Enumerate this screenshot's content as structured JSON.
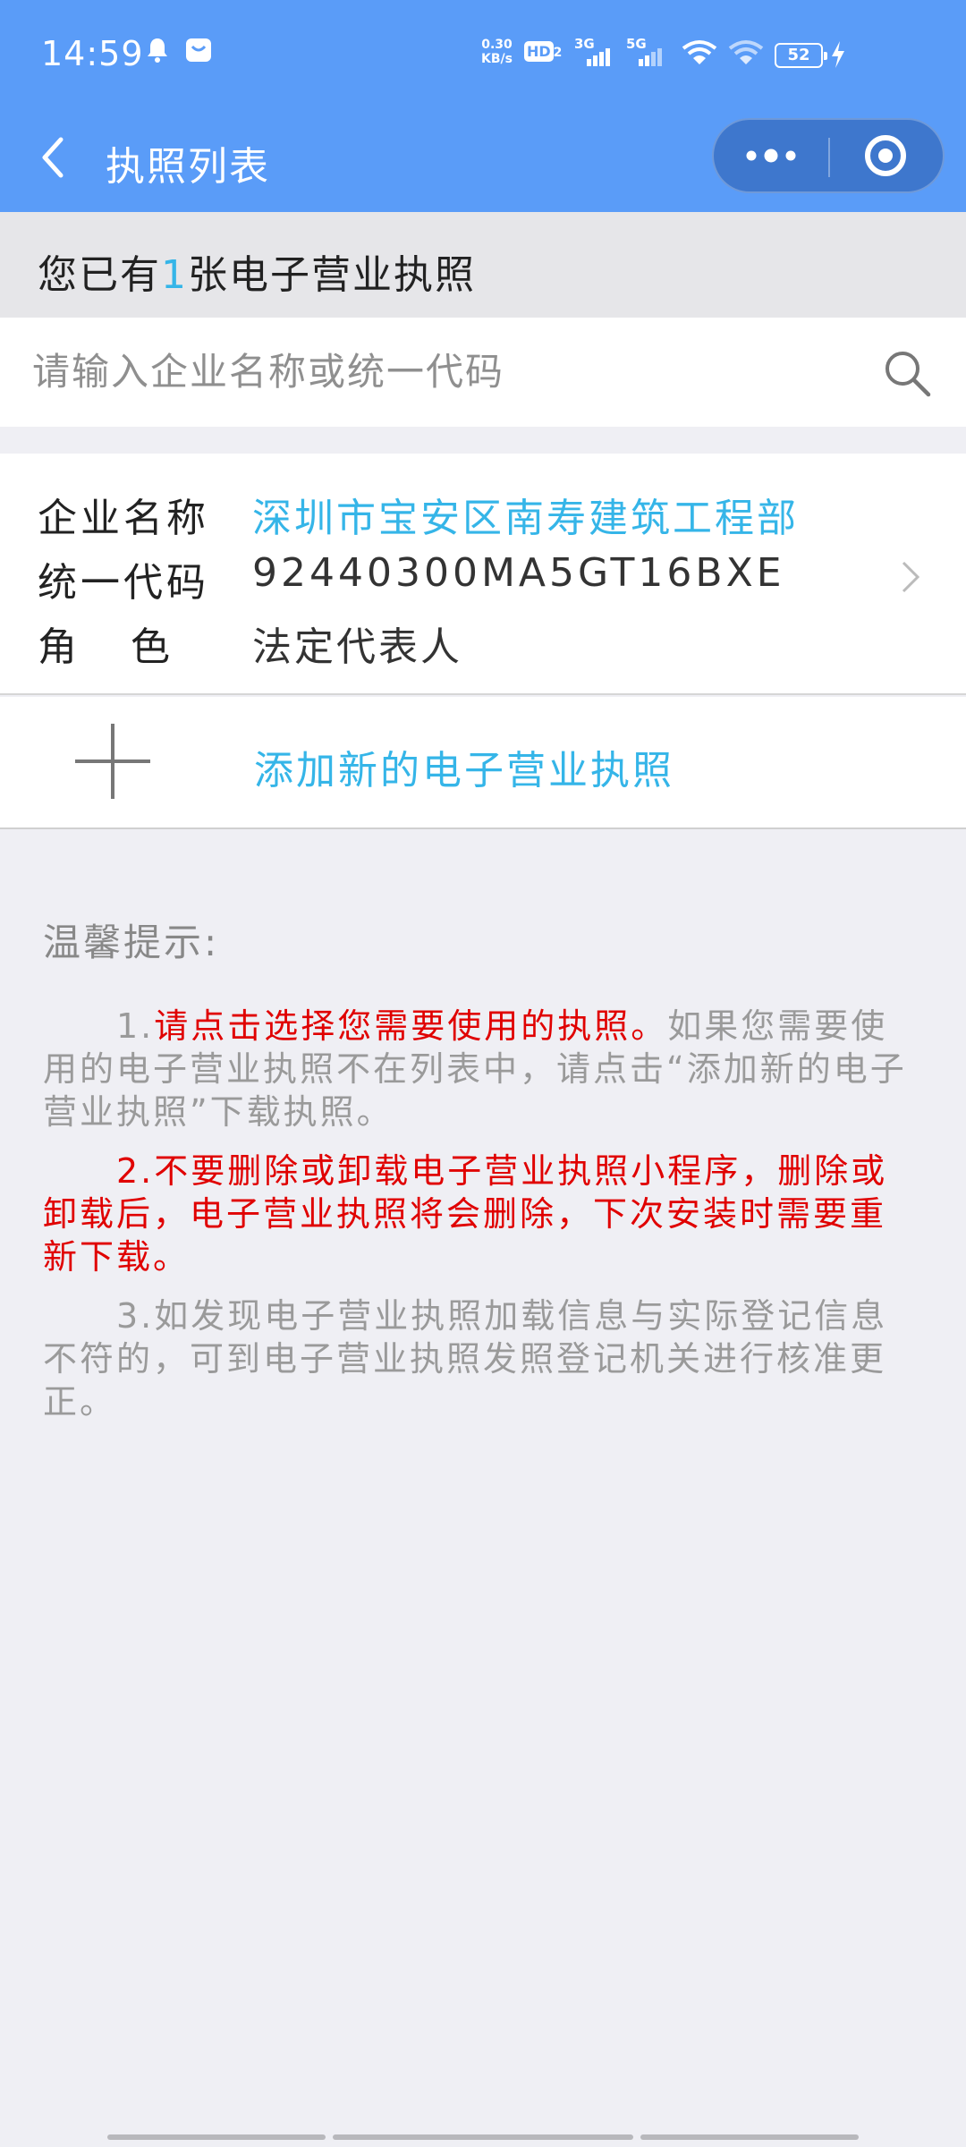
{
  "status_bar": {
    "time": "14:59",
    "net_speed_value": "0.30",
    "net_speed_unit": "KB/s",
    "hd_label": "HD",
    "hd_sub": "2",
    "gen_3g": "3G",
    "gen_5g": "5G",
    "battery": "52"
  },
  "nav": {
    "title": "执照列表"
  },
  "summary": {
    "prefix": "您已有",
    "count": "1",
    "suffix": "张电子营业执照"
  },
  "search": {
    "placeholder": "请输入企业名称或统一代码"
  },
  "license": {
    "name_label": "企业名称",
    "name_value": "深圳市宝安区南寿建筑工程部",
    "code_label": "统一代码",
    "code_value": "92440300MA5GT16BXE",
    "role_label": "角色",
    "role_value": "法定代表人"
  },
  "add": {
    "label": "添加新的电子营业执照"
  },
  "tips": {
    "title": "温馨提示:",
    "tip1_num": "1.",
    "tip1_red": "请点击选择您需要使用的执照。",
    "tip1_rest": "如果您需要使用的电子营业执照不在列表中，请点击“添加新的电子营业执照”下载执照。",
    "tip2": "2.不要删除或卸载电子营业执照小程序，删除或卸载后，电子营业执照将会删除，下次安装时需要重新下载。",
    "tip3": "3.如发现电子营业执照加载信息与实际登记信息不符的，可到电子营业执照发照登记机关进行核准更正。"
  },
  "colors": {
    "header_blue": "#5a9cf8",
    "link_blue": "#35b5e8",
    "warning_red": "#e00000"
  }
}
